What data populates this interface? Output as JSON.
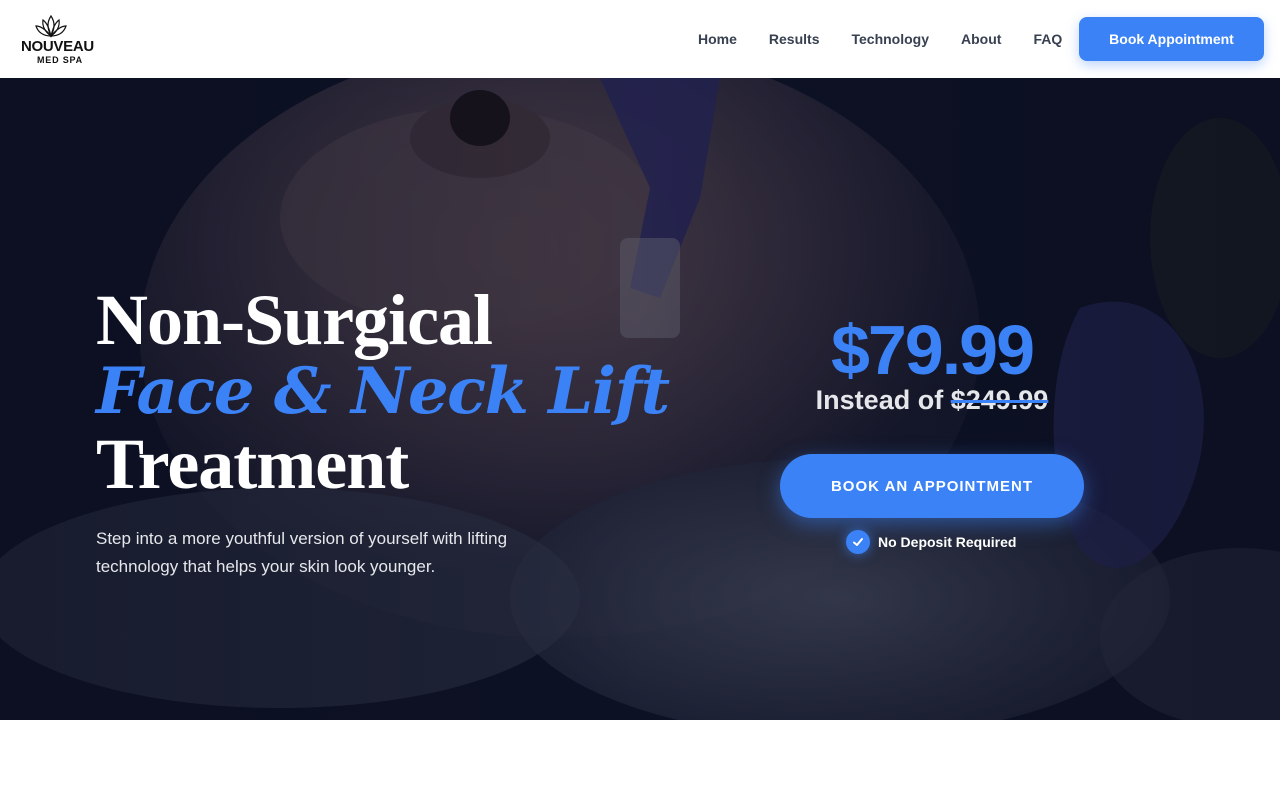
{
  "brand": {
    "name": "NOUVEAU",
    "subtitle": "MED SPA",
    "logo_icon": "lotus-icon"
  },
  "nav": {
    "items": [
      {
        "label": "Home"
      },
      {
        "label": "Results"
      },
      {
        "label": "Technology"
      },
      {
        "label": "About"
      },
      {
        "label": "FAQ"
      }
    ],
    "cta_label": "Book Appointment"
  },
  "hero": {
    "headline_line1": "Non-Surgical",
    "headline_line2": "Face & Neck Lift",
    "headline_line3": "Treatment",
    "subtext": "Step into a more youthful version of yourself with lifting technology that helps your skin look younger.",
    "price": "$79.99",
    "instead_prefix": "Instead of",
    "old_price": "$249.99",
    "cta_label": "BOOK AN APPOINTMENT",
    "no_deposit_label": "No Deposit Required",
    "check_icon": "check-icon"
  },
  "colors": {
    "accent": "#3b82f6",
    "hero_bg": "#0d1122",
    "nav_text": "#374151"
  }
}
